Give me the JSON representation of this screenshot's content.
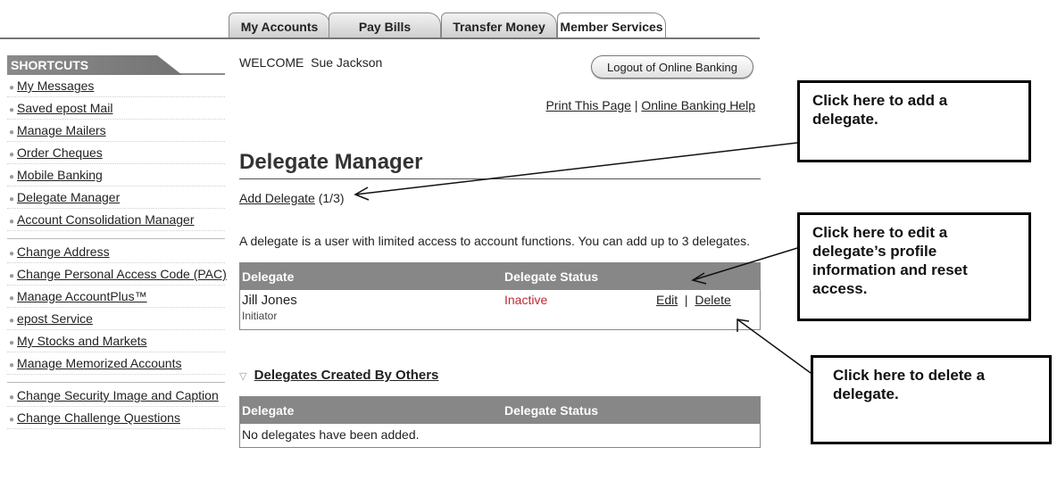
{
  "tabs": [
    {
      "label": "My Accounts",
      "active": false
    },
    {
      "label": "Pay Bills",
      "active": false
    },
    {
      "label": "Transfer Money",
      "active": false
    },
    {
      "label": "Member Services",
      "active": true
    }
  ],
  "sidebar": {
    "header": "SHORTCUTS",
    "groups": [
      [
        "My Messages",
        "Saved epost Mail",
        "Manage Mailers",
        "Order Cheques",
        "Mobile Banking",
        "Delegate Manager",
        "Account Consolidation Manager"
      ],
      [
        "Change Address",
        "Change Personal Access Code (PAC)",
        "Manage AccountPlus™",
        "epost Service",
        "My Stocks and Markets",
        "Manage Memorized Accounts"
      ],
      [
        "Change Security Image and Caption",
        "Change Challenge Questions"
      ]
    ]
  },
  "header": {
    "welcome_label": "WELCOME",
    "user_name": "Sue Jackson",
    "logout_label": "Logout of Online Banking",
    "print_link": "Print This Page",
    "separator": "|",
    "help_link": "Online Banking Help"
  },
  "main": {
    "title": "Delegate Manager",
    "add_delegate_link": "Add Delegate",
    "add_delegate_count": "(1/3)",
    "intro": "A delegate is a user with limited access to account functions. You can add up to 3 delegates.",
    "table": {
      "col_delegate": "Delegate",
      "col_status": "Delegate Status",
      "rows": [
        {
          "name": "Jill Jones",
          "role": "Initiator",
          "status": "Inactive",
          "edit": "Edit",
          "sep": "|",
          "delete": "Delete"
        }
      ]
    },
    "others_section": {
      "title": "Delegates Created By Others",
      "col_delegate": "Delegate",
      "col_status": "Delegate Status",
      "empty_message": "No delegates have been added."
    }
  },
  "callouts": {
    "add": "Click here to add a delegate.",
    "edit": "Click here to edit a delegate’s profile information and reset access.",
    "delete": "Click here to delete a delegate."
  },
  "colors": {
    "status_inactive": "#c0282d",
    "table_header_bg": "#878787"
  }
}
